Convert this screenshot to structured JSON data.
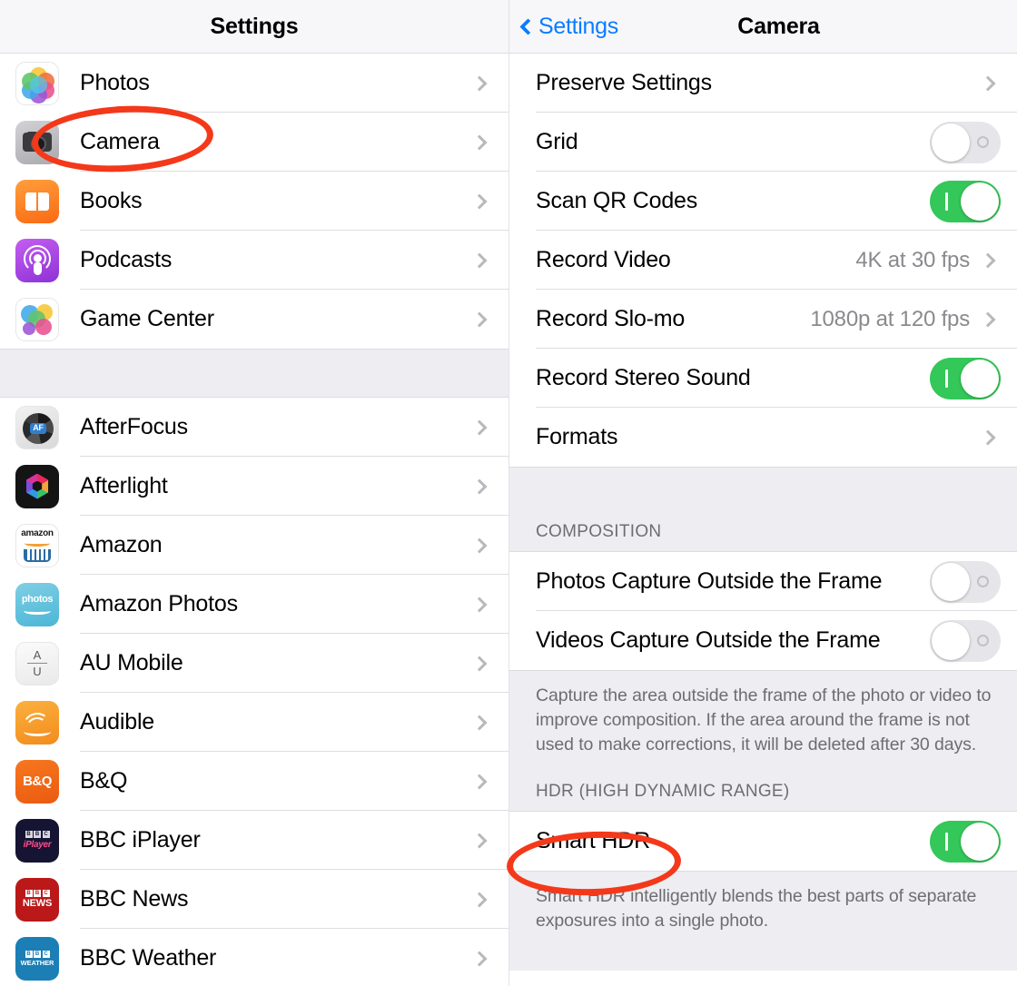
{
  "left_panel": {
    "nav": {
      "title": "Settings"
    },
    "apple_apps": [
      {
        "label": "Photos",
        "icon": "photos-app-icon",
        "accessory": "chevron"
      },
      {
        "label": "Camera",
        "icon": "camera-app-icon",
        "accessory": "chevron",
        "annotated": true
      },
      {
        "label": "Books",
        "icon": "books-app-icon",
        "accessory": "chevron"
      },
      {
        "label": "Podcasts",
        "icon": "podcasts-app-icon",
        "accessory": "chevron"
      },
      {
        "label": "Game Center",
        "icon": "game-center-app-icon",
        "accessory": "chevron"
      }
    ],
    "third_party_apps": [
      {
        "label": "AfterFocus",
        "icon": "afterfocus-app-icon",
        "accessory": "chevron"
      },
      {
        "label": "Afterlight",
        "icon": "afterlight-app-icon",
        "accessory": "chevron"
      },
      {
        "label": "Amazon",
        "icon": "amazon-app-icon",
        "accessory": "chevron"
      },
      {
        "label": "Amazon Photos",
        "icon": "amazon-photos-app-icon",
        "accessory": "chevron"
      },
      {
        "label": "AU Mobile",
        "icon": "au-mobile-app-icon",
        "accessory": "chevron"
      },
      {
        "label": "Audible",
        "icon": "audible-app-icon",
        "accessory": "chevron"
      },
      {
        "label": "B&Q",
        "icon": "bq-app-icon",
        "accessory": "chevron"
      },
      {
        "label": "BBC iPlayer",
        "icon": "bbc-iplayer-app-icon",
        "accessory": "chevron"
      },
      {
        "label": "BBC News",
        "icon": "bbc-news-app-icon",
        "accessory": "chevron"
      },
      {
        "label": "BBC Weather",
        "icon": "bbc-weather-app-icon",
        "accessory": "chevron"
      }
    ],
    "icon_text": {
      "afterfocus_badge": "AF",
      "amazon_wordmark": "amazon",
      "amazon_photos_wordmark": "photos",
      "au_top": "A",
      "au_bottom": "U",
      "bq_wordmark": "B&Q",
      "bbc_b": "B",
      "bbc_b2": "B",
      "bbc_c": "C",
      "iplayer_wordmark": "iPlayer",
      "news_wordmark": "NEWS",
      "weather_wordmark": "WEATHER"
    }
  },
  "right_panel": {
    "nav": {
      "back_label": "Settings",
      "title": "Camera"
    },
    "section_main": [
      {
        "label": "Preserve Settings",
        "accessory": "chevron"
      },
      {
        "label": "Grid",
        "accessory": "toggle",
        "toggle_state": "off"
      },
      {
        "label": "Scan QR Codes",
        "accessory": "toggle",
        "toggle_state": "on"
      },
      {
        "label": "Record Video",
        "accessory": "value-chevron",
        "value": "4K at 30 fps"
      },
      {
        "label": "Record Slo-mo",
        "accessory": "value-chevron",
        "value": "1080p at 120 fps"
      },
      {
        "label": "Record Stereo Sound",
        "accessory": "toggle",
        "toggle_state": "on"
      },
      {
        "label": "Formats",
        "accessory": "chevron"
      }
    ],
    "section_composition": {
      "header": "COMPOSITION",
      "rows": [
        {
          "label": "Photos Capture Outside the Frame",
          "accessory": "toggle",
          "toggle_state": "off"
        },
        {
          "label": "Videos Capture Outside the Frame",
          "accessory": "toggle",
          "toggle_state": "off"
        }
      ],
      "footer": "Capture the area outside the frame of the photo or video to improve composition. If the area around the frame is not used to make corrections, it will be deleted after 30 days."
    },
    "section_hdr": {
      "header": "HDR (HIGH DYNAMIC RANGE)",
      "rows": [
        {
          "label": "Smart HDR",
          "accessory": "toggle",
          "toggle_state": "on",
          "annotated": true
        }
      ],
      "footer": "Smart HDR intelligently blends the best parts of separate exposures into a single photo."
    }
  },
  "annotations": {
    "color": "#f4381a",
    "shapes": [
      {
        "name": "camera-row-highlight",
        "target": "Camera"
      },
      {
        "name": "smart-hdr-row-highlight",
        "target": "Smart HDR"
      }
    ]
  },
  "colors": {
    "accent_blue": "#0a7cff",
    "toggle_on_green": "#34c759",
    "group_background": "#eeeef2",
    "secondary_text": "#8a8a8e",
    "annotation_red": "#f4381a"
  }
}
